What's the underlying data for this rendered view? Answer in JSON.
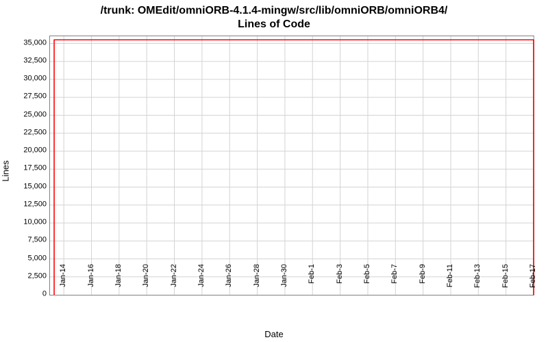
{
  "chart_data": {
    "type": "line",
    "title": "/trunk: OMEdit/omniORB-4.1.4-mingw/src/lib/omniORB/omniORB4/\nLines of Code",
    "xlabel": "Date",
    "ylabel": "Lines",
    "ylim": [
      0,
      36000
    ],
    "y_ticks": [
      0,
      2500,
      5000,
      7500,
      10000,
      12500,
      15000,
      17500,
      20000,
      22500,
      25000,
      27500,
      30000,
      32500,
      35000
    ],
    "y_tick_labels": [
      "0",
      "2,500",
      "5,000",
      "7,500",
      "10,000",
      "12,500",
      "15,000",
      "17,500",
      "20,000",
      "22,500",
      "25,000",
      "27,500",
      "30,000",
      "32,500",
      "35,000"
    ],
    "x_range_days": [
      13,
      48
    ],
    "x_tick_days": [
      14,
      16,
      18,
      20,
      22,
      24,
      26,
      28,
      30,
      32,
      34,
      36,
      38,
      40,
      42,
      44,
      46,
      48
    ],
    "x_tick_labels": [
      "14-Jan",
      "16-Jan",
      "18-Jan",
      "20-Jan",
      "22-Jan",
      "24-Jan",
      "26-Jan",
      "28-Jan",
      "30-Jan",
      "1-Feb",
      "3-Feb",
      "5-Feb",
      "7-Feb",
      "9-Feb",
      "11-Feb",
      "13-Feb",
      "15-Feb",
      "17-Feb"
    ],
    "series": [
      {
        "name": "Lines of Code",
        "color": "#ff0000",
        "points": [
          {
            "day": 13.3,
            "value": 0
          },
          {
            "day": 13.3,
            "value": 35500
          },
          {
            "day": 48,
            "value": 35500
          },
          {
            "day": 48,
            "value": 0
          }
        ]
      }
    ]
  }
}
